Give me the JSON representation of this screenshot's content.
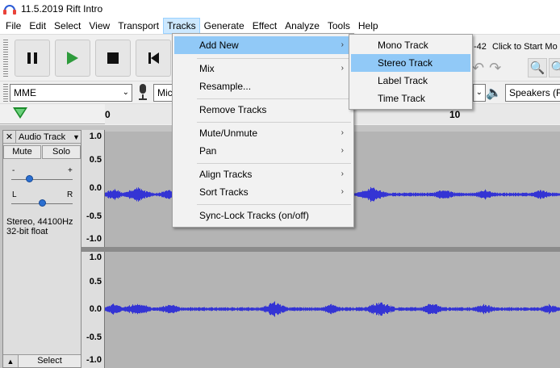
{
  "window": {
    "title": "11.5.2019 Rift Intro"
  },
  "menubar": {
    "items": [
      {
        "key": "file",
        "label": "File"
      },
      {
        "key": "edit",
        "label": "Edit"
      },
      {
        "key": "select",
        "label": "Select"
      },
      {
        "key": "view",
        "label": "View"
      },
      {
        "key": "transport",
        "label": "Transport"
      },
      {
        "key": "tracks",
        "label": "Tracks"
      },
      {
        "key": "generate",
        "label": "Generate"
      },
      {
        "key": "effect",
        "label": "Effect"
      },
      {
        "key": "analyze",
        "label": "Analyze"
      },
      {
        "key": "tools",
        "label": "Tools"
      },
      {
        "key": "help",
        "label": "Help"
      }
    ],
    "active": "Tracks"
  },
  "toolbar": {
    "pause_icon": "pause-icon",
    "play_icon": "play-icon",
    "stop_icon": "stop-icon",
    "skip_start_icon": "skip-to-start-icon",
    "meter_value": "-42",
    "click_to_start": "Click to Start Mo"
  },
  "device_bar": {
    "host": "MME",
    "recording_device": "Mic",
    "playback_device": "Speakers (Re"
  },
  "timeline": {
    "labels": [
      "0",
      "10"
    ]
  },
  "track": {
    "name": "Audio Track",
    "mute_label": "Mute",
    "solo_label": "Solo",
    "gain_minus": "-",
    "gain_plus": "+",
    "pan_left": "L",
    "pan_right": "R",
    "info_line1": "Stereo, 44100Hz",
    "info_line2": "32-bit float",
    "select_label": "Select",
    "ruler_labels": [
      "1.0",
      "0.5",
      "0.0",
      "-0.5",
      "-1.0"
    ],
    "waveform_color": "#3434d4"
  },
  "tracks_menu": {
    "items": [
      {
        "label": "Add New",
        "submenu": true,
        "highlighted": true
      },
      {
        "label": "Mix",
        "submenu": true
      },
      {
        "label": "Resample..."
      },
      {
        "label": "Remove Tracks"
      },
      {
        "label": "Mute/Unmute",
        "submenu": true
      },
      {
        "label": "Pan",
        "submenu": true
      },
      {
        "label": "Align Tracks",
        "submenu": true
      },
      {
        "label": "Sort Tracks",
        "submenu": true
      },
      {
        "label": "Sync-Lock Tracks (on/off)"
      }
    ]
  },
  "add_new_submenu": {
    "items": [
      {
        "label": "Mono Track"
      },
      {
        "label": "Stereo Track",
        "highlighted": true
      },
      {
        "label": "Label Track"
      },
      {
        "label": "Time Track"
      }
    ]
  },
  "colors": {
    "menu_highlight": "#91c9f7",
    "active_menu": "#cce8ff",
    "waveform_bg": "#b4b4b4",
    "waveform": "#3434d4",
    "play_green": "#2e9b3c"
  }
}
